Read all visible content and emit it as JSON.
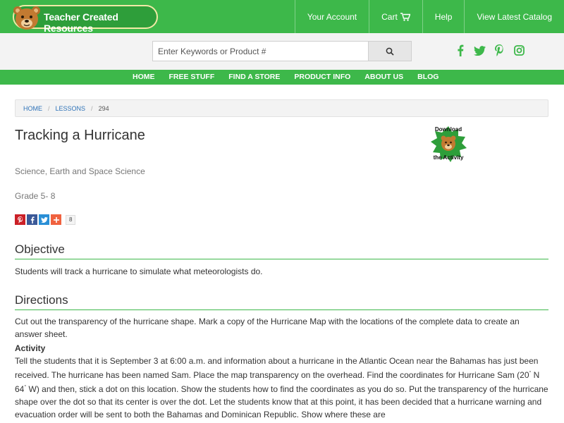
{
  "brand": {
    "name": "Teacher Created Resources"
  },
  "topnav": {
    "account": "Your Account",
    "cart": "Cart",
    "help": "Help",
    "catalog": "View Latest Catalog"
  },
  "search": {
    "placeholder": "Enter Keywords or Product #"
  },
  "social_top": [
    "facebook-icon",
    "twitter-icon",
    "pinterest-icon",
    "instagram-icon"
  ],
  "mainnav": [
    "HOME",
    "FREE STUFF",
    "FIND A STORE",
    "PRODUCT INFO",
    "ABOUT US",
    "BLOG"
  ],
  "breadcrumb": {
    "home": "HOME",
    "lessons": "LESSONS",
    "current": "294",
    "sep": "/"
  },
  "lesson": {
    "title": "Tracking a Hurricane",
    "subject": "Science, Earth and Space Science",
    "grade": "Grade 5- 8",
    "download_line1": "Download",
    "download_line2": "the Activity"
  },
  "share": {
    "count": "8"
  },
  "objective": {
    "heading": "Objective",
    "text": "Students will track a hurricane to simulate what meteorologists do."
  },
  "directions": {
    "heading": "Directions",
    "text": "Cut out the transparency of the hurricane shape. Mark a copy of the Hurricane Map with the locations of the complete data to create an answer sheet.",
    "activity_label": "Activity",
    "activity_a": "Tell the students that it is September 3 at 6:00 a.m. and information about a hurricane in the Atlantic Ocean near the Bahamas has just been received. The hurricane has been named Sam. Place the map transparency on the overhead. Find the coordinates for Hurricane Sam (20",
    "activity_b": " N 64",
    "activity_c": " W) and then, stick a dot on this location. Show the students how to find the coordinates as you do so. Put the transparency of the hurricane shape over the dot so that its center is over the dot. Let the students know that at this point, it has been decided that a hurricane warning and evacuation order will be sent to both the Bahamas and Dominican Republic. Show where these are",
    "degree": "°"
  },
  "colors": {
    "brand_green": "#3db84a",
    "link_blue": "#2f73b8",
    "heading_text": "#333333"
  }
}
